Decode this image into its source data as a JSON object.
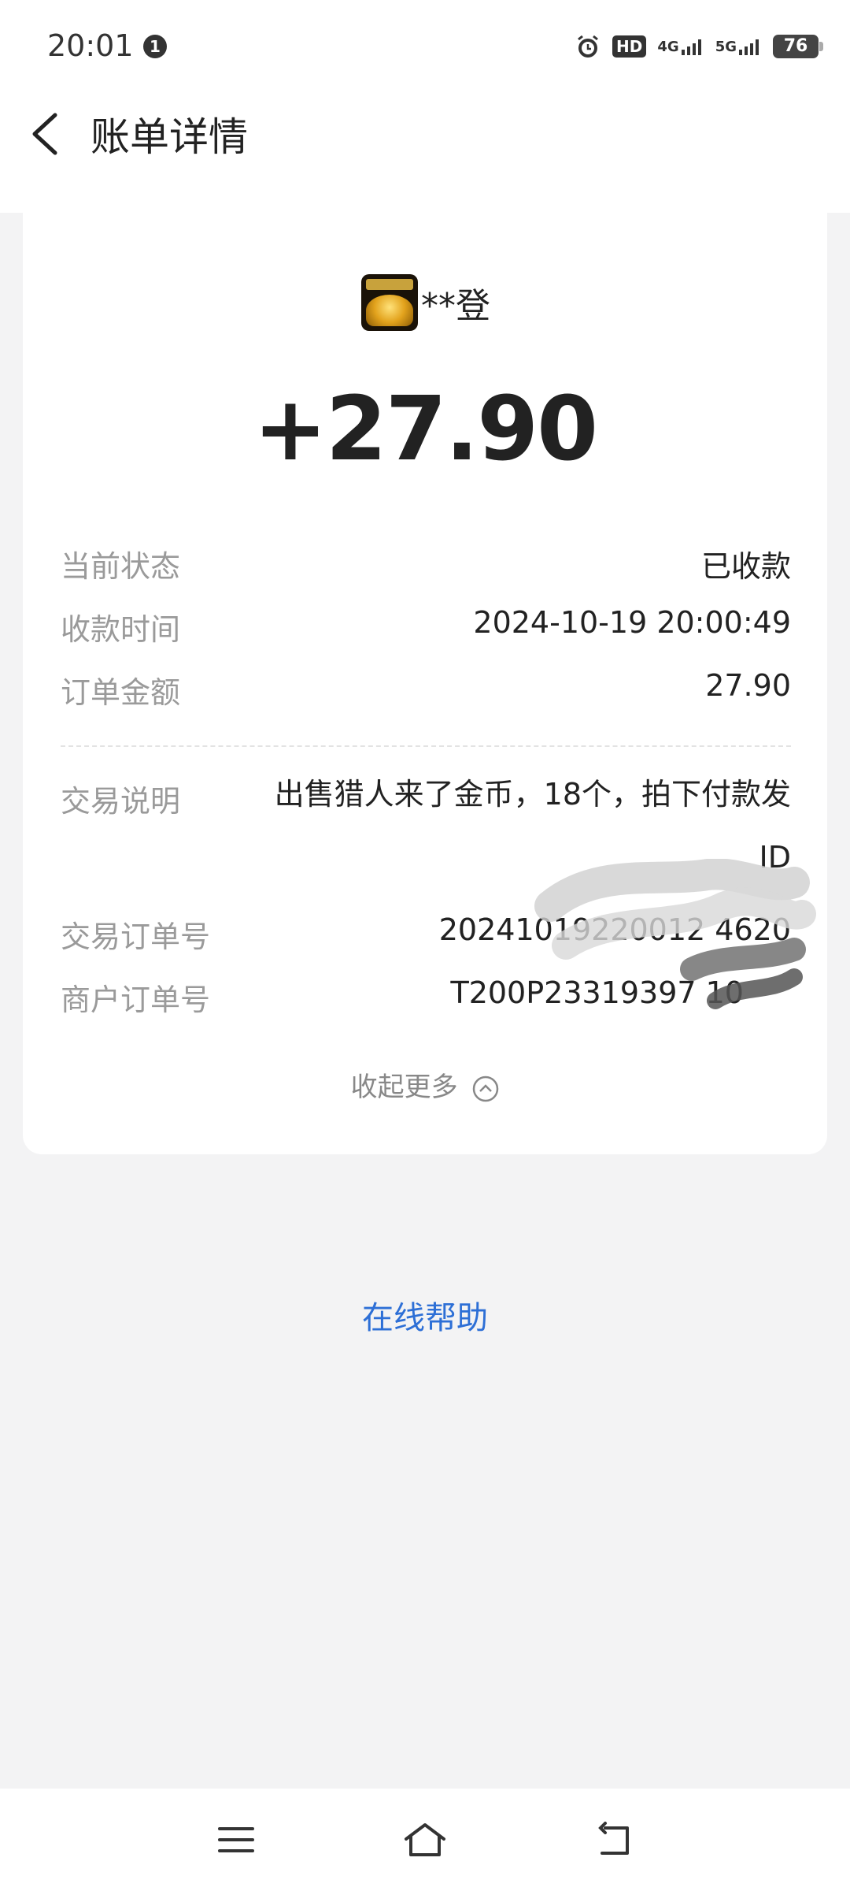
{
  "status_bar": {
    "time": "20:01",
    "notification_count": "1",
    "hd_label": "HD",
    "network_4g": "4G",
    "network_5g": "5G",
    "battery": "76"
  },
  "header": {
    "title": "账单详情"
  },
  "merchant": {
    "name": "**登"
  },
  "amount": "+27.90",
  "details": {
    "status_label": "当前状态",
    "status_value": "已收款",
    "time_label": "收款时间",
    "time_value": "2024-10-19 20:00:49",
    "order_amount_label": "订单金额",
    "order_amount_value": "27.90",
    "description_label": "交易说明",
    "description_value": "出售猎人来了金币，18个，拍下付款发ID",
    "trade_no_label": "交易订单号",
    "trade_no_value": "20241019220012  4620",
    "merchant_no_label": "商户订单号",
    "merchant_no_value": "T200P23319397  10"
  },
  "collapse_label": "收起更多",
  "help_label": "在线帮助",
  "nav": {
    "menu_icon": "menu-icon",
    "home_icon": "home-icon",
    "back_icon": "back-nav-icon"
  }
}
